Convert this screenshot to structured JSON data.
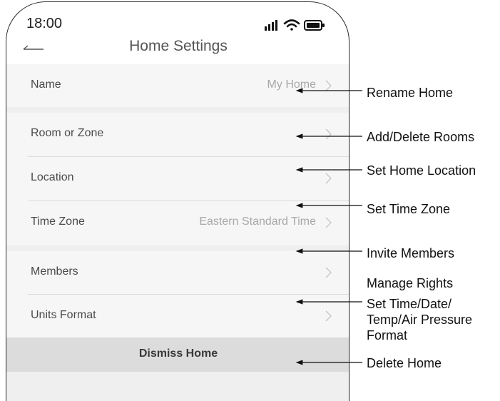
{
  "status_bar": {
    "time": "18:00",
    "icons": [
      "signal-icon",
      "wifi-icon",
      "battery-icon"
    ]
  },
  "header": {
    "title": "Home Settings",
    "back_icon": "back-arrow-icon"
  },
  "rows": [
    {
      "label": "Name",
      "value": "My Home"
    },
    {
      "label": "Room or Zone",
      "value": ""
    },
    {
      "label": "Location",
      "value": ""
    },
    {
      "label": "Time Zone",
      "value": "Eastern Standard Time"
    },
    {
      "label": "Members",
      "value": ""
    },
    {
      "label": "Units Format",
      "value": ""
    }
  ],
  "dismiss_label": "Dismiss Home",
  "annotations": [
    "Rename Home",
    "Add/Delete Rooms",
    "Set Home Location",
    "Set Time Zone",
    "Invite Members",
    "Manage Rights",
    "Set Time/Date/",
    "Temp/Air Pressure",
    "Format",
    "Delete Home"
  ],
  "colors": {
    "list_bg": "#f6f6f6",
    "separator_bg": "#efefef",
    "dismiss_bg": "#dcdcdc",
    "value_text": "#a8a8a8"
  }
}
